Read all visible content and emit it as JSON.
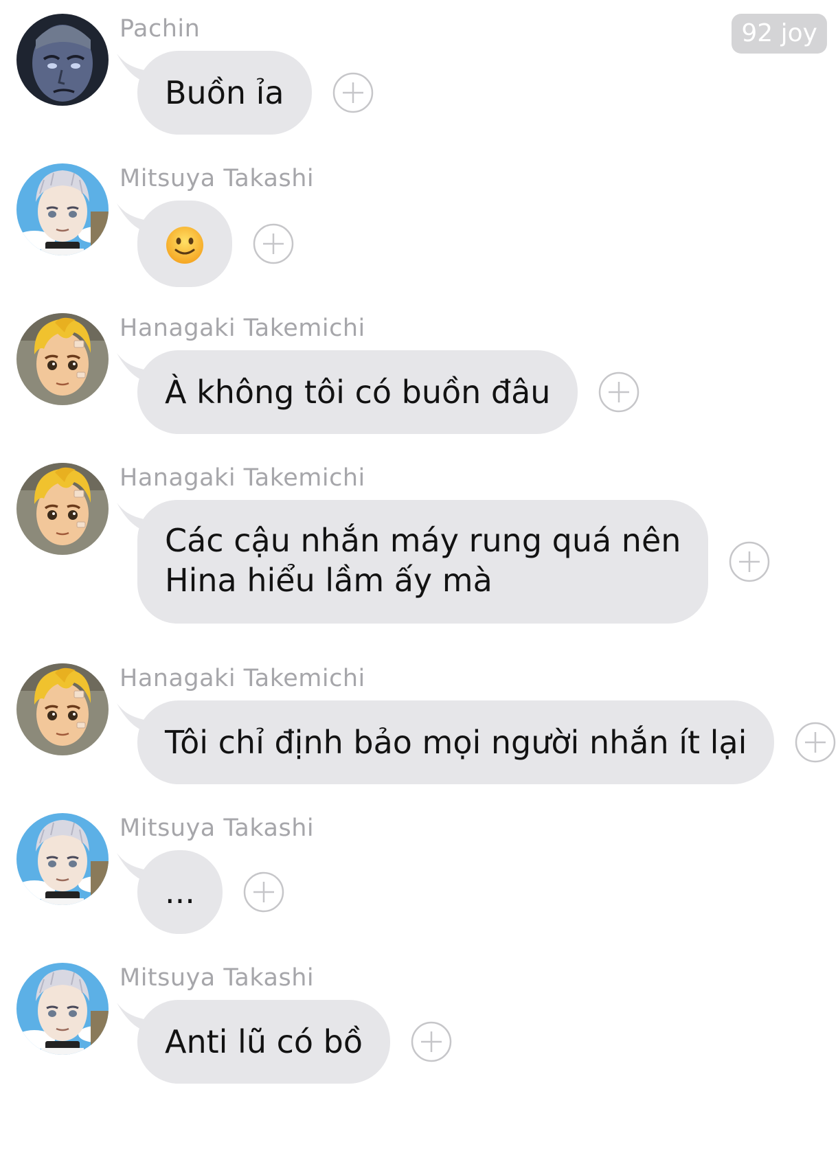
{
  "header": {
    "reaction_badge": "92 joy"
  },
  "messages": [
    {
      "sender": "Pachin",
      "avatar": "pachin-avatar",
      "text": "Buồn ỉa"
    },
    {
      "sender": "Mitsuya Takashi",
      "avatar": "mitsuya-avatar",
      "text": "",
      "emoji": "slightly-smiling-face"
    },
    {
      "sender": "Hanagaki Takemichi",
      "avatar": "takemichi-avatar",
      "text": "À không tôi có buồn đâu"
    },
    {
      "sender": "Hanagaki Takemichi",
      "avatar": "takemichi-avatar",
      "text_line1": "Các cậu nhắn máy rung quá nên",
      "text_line2": "Hina hiểu lầm ấy mà"
    },
    {
      "sender": "Hanagaki Takemichi",
      "avatar": "takemichi-avatar",
      "text": "Tôi chỉ định bảo mọi người nhắn ít lại"
    },
    {
      "sender": "Mitsuya Takashi",
      "avatar": "mitsuya-avatar",
      "text": "..."
    },
    {
      "sender": "Mitsuya Takashi",
      "avatar": "mitsuya-avatar",
      "text": "Anti lũ có bồ"
    }
  ],
  "icons": {
    "reaction_add": "plus-circle-icon"
  },
  "colors": {
    "bubble": "#e6e6e9",
    "sender_name": "#a6a6aa",
    "badge_bg": "#d4d4d6",
    "react_icon": "#c6c6c9"
  }
}
